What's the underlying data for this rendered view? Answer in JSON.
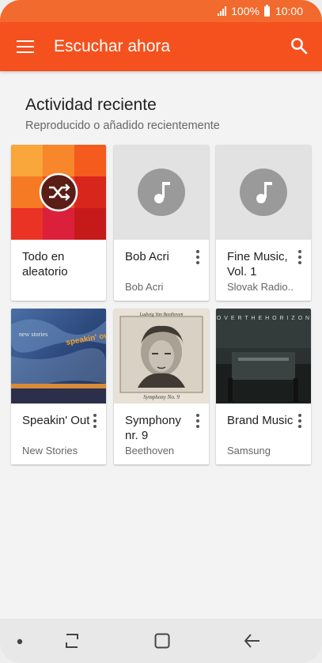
{
  "status_bar": {
    "battery": "100%",
    "time": "10:00"
  },
  "app_bar": {
    "title": "Escuchar ahora",
    "menu_icon": "hamburger-menu-icon",
    "search_icon": "search-icon"
  },
  "section": {
    "title": "Actividad reciente",
    "subtitle": "Reproducido o añadido recientemente"
  },
  "cards": [
    {
      "title": "Todo en aleatorio",
      "subtitle": "",
      "art": "shuffle-mosaic"
    },
    {
      "title": "Bob Acri",
      "subtitle": "Bob Acri",
      "art": "music-note-placeholder"
    },
    {
      "title": "Fine Music, Vol. 1",
      "subtitle": "Slovak Radio..",
      "art": "music-note-placeholder"
    },
    {
      "title": "Speakin' Out",
      "subtitle": "New Stories",
      "art": "album-cover",
      "cover_text": "new stories",
      "cover_text2": "speakin' out"
    },
    {
      "title": "Symphony nr. 9",
      "subtitle": "Beethoven",
      "art": "album-cover",
      "cover_text": "Ludwig Van Beethoven",
      "cover_text2": "Symphony No. 9"
    },
    {
      "title": "Brand Music",
      "subtitle": "Samsung",
      "art": "album-cover",
      "cover_text": "O V E R T H E H O R I Z O N"
    }
  ],
  "nav_bar": {
    "icons": [
      "dot-icon",
      "recent-apps-icon",
      "home-icon",
      "back-icon"
    ]
  },
  "colors": {
    "app_bar": "#f4511e",
    "status_bar": "#f26a2e",
    "background": "#f3f3f3"
  }
}
